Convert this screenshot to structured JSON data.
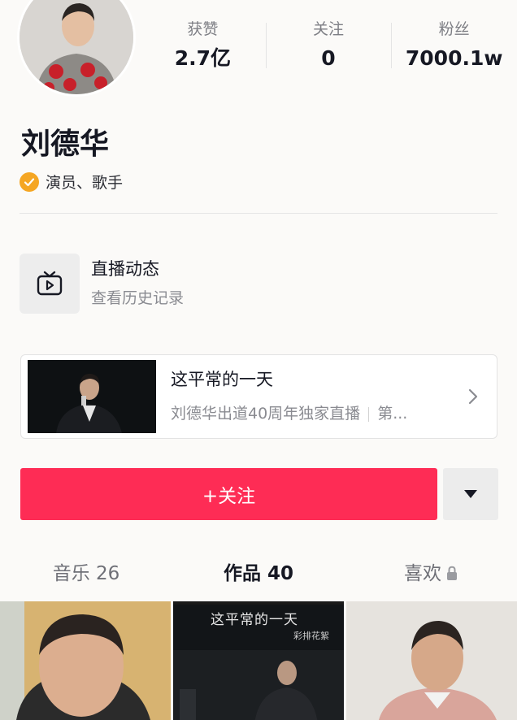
{
  "profile": {
    "name": "刘德华",
    "verified_label": "演员、歌手",
    "stats": [
      {
        "label": "获赞",
        "value": "2.7亿"
      },
      {
        "label": "关注",
        "value": "0"
      },
      {
        "label": "粉丝",
        "value": "7000.1w"
      }
    ]
  },
  "live": {
    "title": "直播动态",
    "subtitle": "查看历史记录",
    "icon": "tv-icon"
  },
  "featured": {
    "title": "这平常的一天",
    "subtitle": "刘德华出道40周年独家直播",
    "subtitle_tail": "第..."
  },
  "actions": {
    "follow_label": "+关注",
    "more_icon": "caret-down-icon"
  },
  "tabs": [
    {
      "label": "音乐 26",
      "active": false
    },
    {
      "label": "作品 40",
      "active": true
    },
    {
      "label": "喜欢",
      "active": false,
      "locked": true
    }
  ],
  "video_grid": {
    "thumb2_title": "这平常的一天",
    "thumb2_tag": "彩排花絮"
  },
  "colors": {
    "accent": "#fe2c55",
    "verify_badge": "#f5a623",
    "background": "#fbfaf8"
  }
}
